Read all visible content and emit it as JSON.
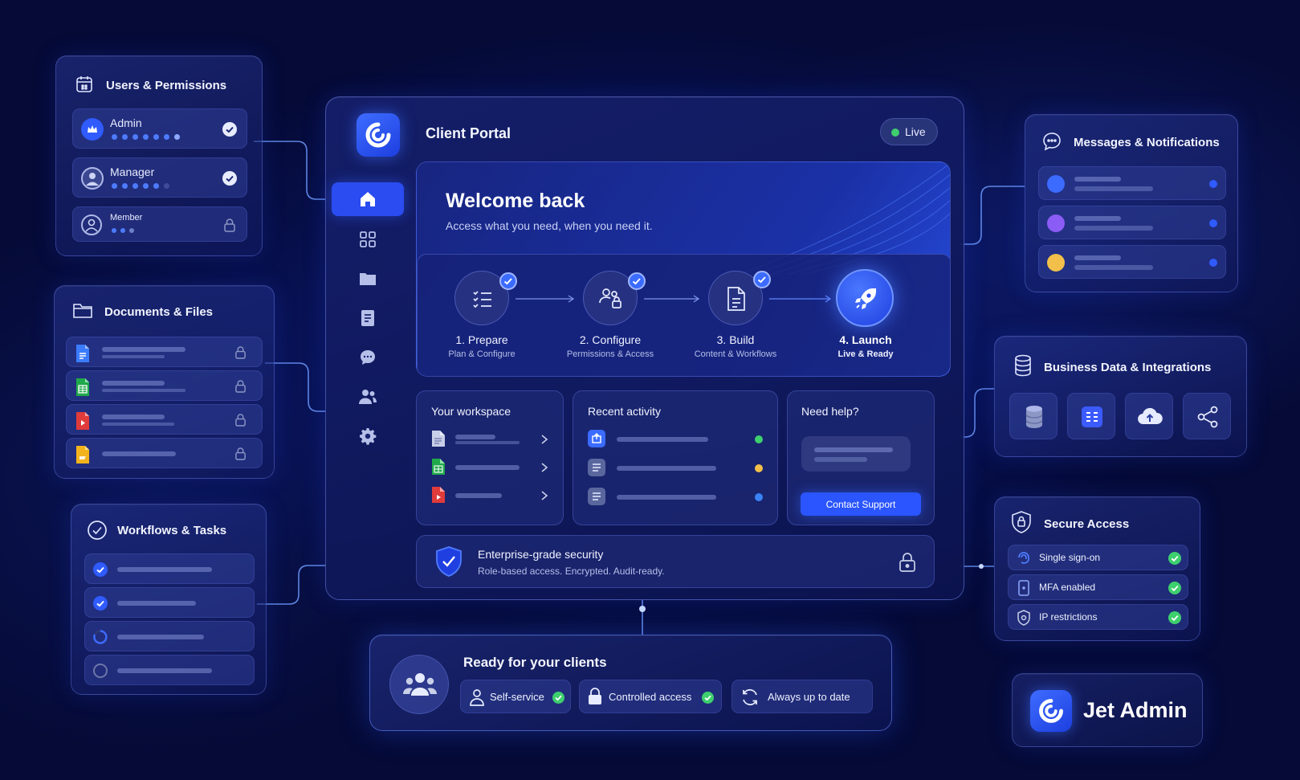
{
  "users_panel": {
    "title": "Users & Permissions",
    "items": [
      {
        "label": "Admin"
      },
      {
        "label": "Manager"
      },
      {
        "label": "Member"
      }
    ]
  },
  "documents_panel": {
    "title": "Documents & Files"
  },
  "workflows_panel": {
    "title": "Workflows & Tasks"
  },
  "portal": {
    "title": "Client Portal",
    "status": "Live",
    "welcome_title": "Welcome back",
    "welcome_subtitle": "Access what you need, when you need it.",
    "steps": [
      {
        "title": "1. Prepare",
        "subtitle": "Plan & Configure"
      },
      {
        "title": "2. Configure",
        "subtitle": "Permissions & Access"
      },
      {
        "title": "3. Build",
        "subtitle": "Content & Workflows"
      },
      {
        "title": "4. Launch",
        "subtitle": "Live & Ready"
      }
    ],
    "workspace_title": "Your workspace",
    "activity_title": "Recent activity",
    "help_title": "Need help?",
    "contact_button": "Contact Support",
    "security_title": "Enterprise-grade security",
    "security_subtitle": "Role-based access. Encrypted. Audit-ready."
  },
  "messages_panel": {
    "title": "Messages & Notifications"
  },
  "business_panel": {
    "title": "Business Data & Integrations"
  },
  "secure_panel": {
    "title": "Secure Access",
    "items": [
      {
        "label": "Single sign-on"
      },
      {
        "label": "MFA enabled"
      },
      {
        "label": "IP restrictions"
      }
    ]
  },
  "ready_panel": {
    "title": "Ready for your clients",
    "features": [
      {
        "label": "Self-service"
      },
      {
        "label": "Controlled access"
      },
      {
        "label": "Always up to date"
      }
    ]
  },
  "brand": {
    "name": "Jet Admin"
  },
  "colors": {
    "accent": "#2f5bff",
    "success": "#3ecf6e",
    "warning": "#f2c04a",
    "info": "#3b82f6",
    "purple": "#8b5cf6"
  }
}
